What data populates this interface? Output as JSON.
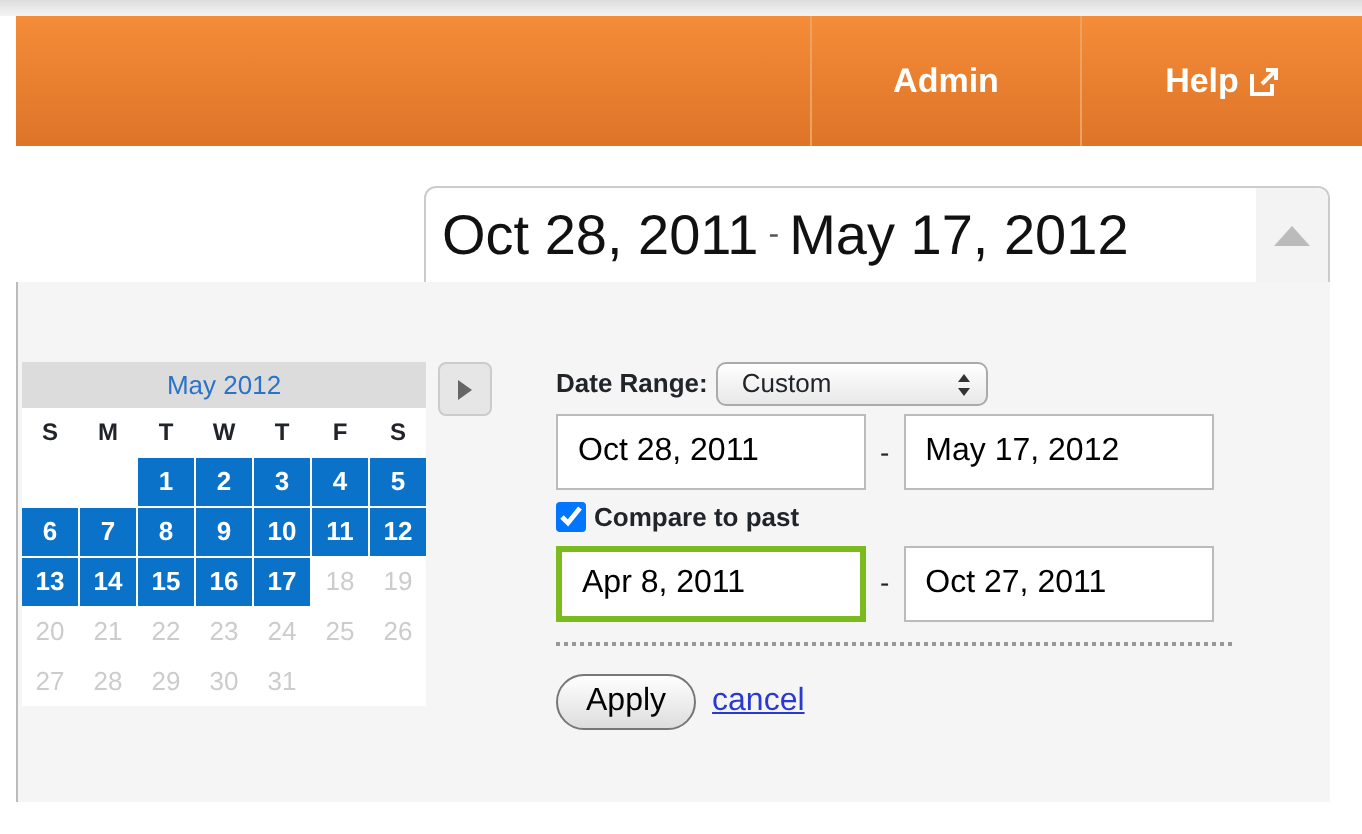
{
  "topbar": {
    "items": [
      {
        "label": "Admin",
        "external": false
      },
      {
        "label": "Help",
        "external": true
      }
    ]
  },
  "date_display": {
    "start": "Oct 28, 2011",
    "separator": "-",
    "end": "May 17, 2012",
    "expanded": true
  },
  "calendar": {
    "month": "May 2012",
    "weekdays": [
      "S",
      "M",
      "T",
      "W",
      "T",
      "F",
      "S"
    ],
    "weeks": [
      [
        {
          "kind": "blank"
        },
        {
          "kind": "blank"
        },
        {
          "kind": "day",
          "day": "1",
          "in_range": true,
          "disabled": false
        },
        {
          "kind": "day",
          "day": "2",
          "in_range": true,
          "disabled": false
        },
        {
          "kind": "day",
          "day": "3",
          "in_range": true,
          "disabled": false
        },
        {
          "kind": "day",
          "day": "4",
          "in_range": true,
          "disabled": false
        },
        {
          "kind": "day",
          "day": "5",
          "in_range": true,
          "disabled": false
        }
      ],
      [
        {
          "kind": "day",
          "day": "6",
          "in_range": true,
          "disabled": false
        },
        {
          "kind": "day",
          "day": "7",
          "in_range": true,
          "disabled": false
        },
        {
          "kind": "day",
          "day": "8",
          "in_range": true,
          "disabled": false
        },
        {
          "kind": "day",
          "day": "9",
          "in_range": true,
          "disabled": false
        },
        {
          "kind": "day",
          "day": "10",
          "in_range": true,
          "disabled": false
        },
        {
          "kind": "day",
          "day": "11",
          "in_range": true,
          "disabled": false
        },
        {
          "kind": "day",
          "day": "12",
          "in_range": true,
          "disabled": false
        }
      ],
      [
        {
          "kind": "day",
          "day": "13",
          "in_range": true,
          "disabled": false
        },
        {
          "kind": "day",
          "day": "14",
          "in_range": true,
          "disabled": false
        },
        {
          "kind": "day",
          "day": "15",
          "in_range": true,
          "disabled": false
        },
        {
          "kind": "day",
          "day": "16",
          "in_range": true,
          "disabled": false
        },
        {
          "kind": "day",
          "day": "17",
          "in_range": true,
          "disabled": false
        },
        {
          "kind": "day",
          "day": "18",
          "in_range": false,
          "disabled": true
        },
        {
          "kind": "day",
          "day": "19",
          "in_range": false,
          "disabled": true
        }
      ],
      [
        {
          "kind": "day",
          "day": "20",
          "in_range": false,
          "disabled": true
        },
        {
          "kind": "day",
          "day": "21",
          "in_range": false,
          "disabled": true
        },
        {
          "kind": "day",
          "day": "22",
          "in_range": false,
          "disabled": true
        },
        {
          "kind": "day",
          "day": "23",
          "in_range": false,
          "disabled": true
        },
        {
          "kind": "day",
          "day": "24",
          "in_range": false,
          "disabled": true
        },
        {
          "kind": "day",
          "day": "25",
          "in_range": false,
          "disabled": true
        },
        {
          "kind": "day",
          "day": "26",
          "in_range": false,
          "disabled": true
        }
      ],
      [
        {
          "kind": "day",
          "day": "27",
          "in_range": false,
          "disabled": true
        },
        {
          "kind": "day",
          "day": "28",
          "in_range": false,
          "disabled": true
        },
        {
          "kind": "day",
          "day": "29",
          "in_range": false,
          "disabled": true
        },
        {
          "kind": "day",
          "day": "30",
          "in_range": false,
          "disabled": true
        },
        {
          "kind": "day",
          "day": "31",
          "in_range": false,
          "disabled": true
        },
        {
          "kind": "blank"
        },
        {
          "kind": "blank"
        }
      ]
    ]
  },
  "form": {
    "range_label": "Date Range:",
    "range_value": "Custom",
    "start": "Oct 28, 2011",
    "end": "May 17, 2012",
    "separator": "-",
    "compare": {
      "label": "Compare to past",
      "checked": true
    },
    "compare_start": {
      "value": "Apr 8, 2011",
      "focused": true
    },
    "compare_separator": "-",
    "compare_end": {
      "value": "Oct 27, 2011",
      "focused": false
    },
    "apply": "Apply",
    "cancel": "cancel"
  }
}
